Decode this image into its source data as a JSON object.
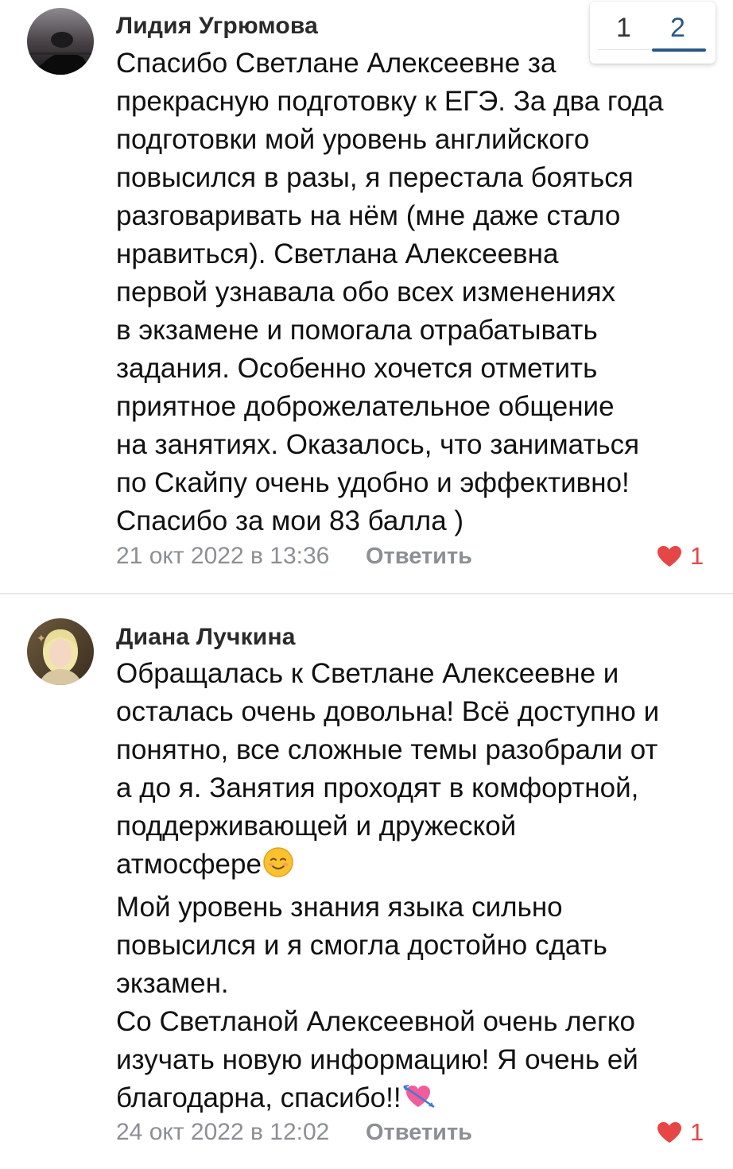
{
  "pager": {
    "pages": [
      "1",
      "2"
    ],
    "active": "2"
  },
  "comments": [
    {
      "author": "Лидия Угрюмова",
      "avatar_icon": "user-photo-dark",
      "text_lines": [
        "Спасибо Светлане Алексеевне за",
        "прекрасную подготовку к ЕГЭ. За два года",
        "подготовки мой уровень английского",
        "повысился в разы, я перестала бояться",
        "разговаривать на нём (мне даже стало",
        "нравиться). Светлана Алексеевна",
        "первой узнавала обо всех изменениях",
        "в экзамене и помогала отрабатывать",
        "задания. Особенно хочется отметить",
        "приятное доброжелательное общение",
        "на занятиях. Оказалось, что заниматься",
        "по Скайпу очень удобно и эффективно!",
        "Спасибо за мои 83 балла )"
      ],
      "date": "21 окт 2022 в 13:36",
      "reply_label": "Ответить",
      "like_count": "1"
    },
    {
      "author": "Диана Лучкина",
      "avatar_icon": "user-photo-light",
      "text_lines": [
        "Обращалась к Светлане Алексеевне и",
        "осталась очень довольна! Всё доступно и",
        "понятно, все сложные темы разобрали от",
        "а до я. Занятия проходят в комфортной,",
        "поддерживающей и дружеской",
        "атмосфере",
        "Мой уровень знания языка сильно",
        "повысился и я смогла достойно сдать",
        "экзамен.",
        "Со Светланой Алексеевной очень легко",
        "изучать новую информацию! Я очень ей",
        "благодарна, спасибо!!"
      ],
      "date": "24 окт 2022 в 12:02",
      "reply_label": "Ответить",
      "like_count": "1"
    }
  ],
  "colors": {
    "like_red": "#e64646",
    "meta_gray": "#8c8f94",
    "accent_blue": "#2a5885"
  }
}
